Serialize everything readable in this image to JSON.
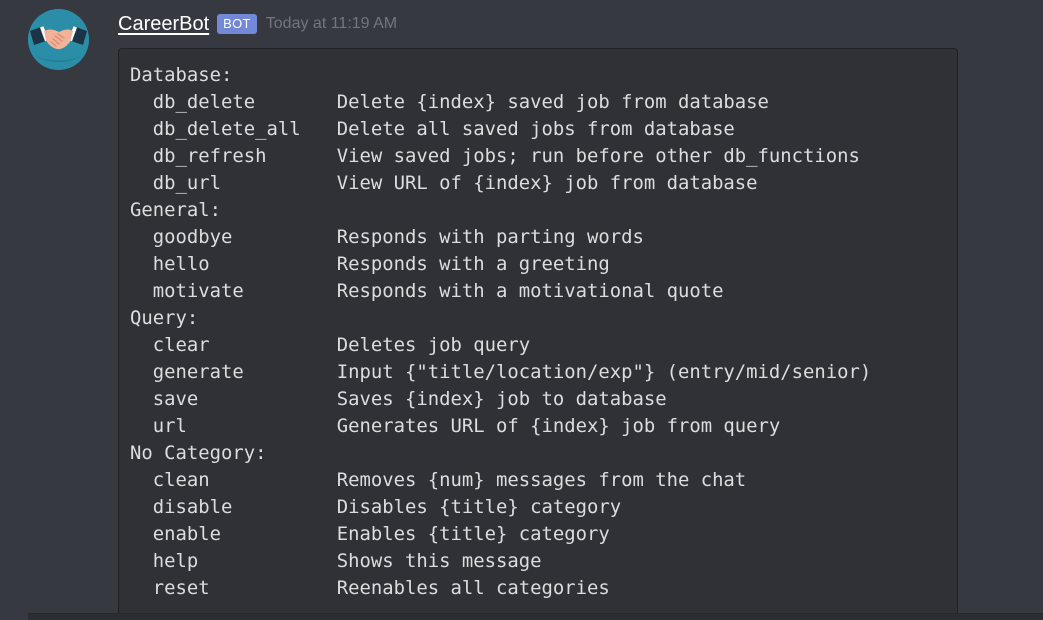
{
  "message": {
    "author": "CareerBot",
    "bot_tag": "BOT",
    "timestamp": "Today at 11:19 AM",
    "avatar_icon": "handshake-icon"
  },
  "colors": {
    "background": "#36393f",
    "code_background": "#2f3136",
    "bot_tag": "#7289da",
    "timestamp": "#72767d",
    "code_text": "#dcddde"
  },
  "help": {
    "sections": [
      {
        "title": "Database:",
        "commands": [
          {
            "name": "db_delete",
            "description": "Delete {index} saved job from database"
          },
          {
            "name": "db_delete_all",
            "description": "Delete all saved jobs from database"
          },
          {
            "name": "db_refresh",
            "description": "View saved jobs; run before other db_functions"
          },
          {
            "name": "db_url",
            "description": "View URL of {index} job from database"
          }
        ]
      },
      {
        "title": "General:",
        "commands": [
          {
            "name": "goodbye",
            "description": "Responds with parting words"
          },
          {
            "name": "hello",
            "description": "Responds with a greeting"
          },
          {
            "name": "motivate",
            "description": "Responds with a motivational quote"
          }
        ]
      },
      {
        "title": "Query:",
        "commands": [
          {
            "name": "clear",
            "description": "Deletes job query"
          },
          {
            "name": "generate",
            "description": "Input {\"title/location/exp\"} (entry/mid/senior)"
          },
          {
            "name": "save",
            "description": "Saves {index} job to database"
          },
          {
            "name": "url",
            "description": "Generates URL of {index} job from query"
          }
        ]
      },
      {
        "title": "No Category:",
        "commands": [
          {
            "name": "clean",
            "description": "Removes {num} messages from the chat"
          },
          {
            "name": "disable",
            "description": "Disables {title} category"
          },
          {
            "name": "enable",
            "description": "Enables {title} category"
          },
          {
            "name": "help",
            "description": "Shows this message"
          },
          {
            "name": "reset",
            "description": "Reenables all categories"
          }
        ]
      }
    ]
  }
}
